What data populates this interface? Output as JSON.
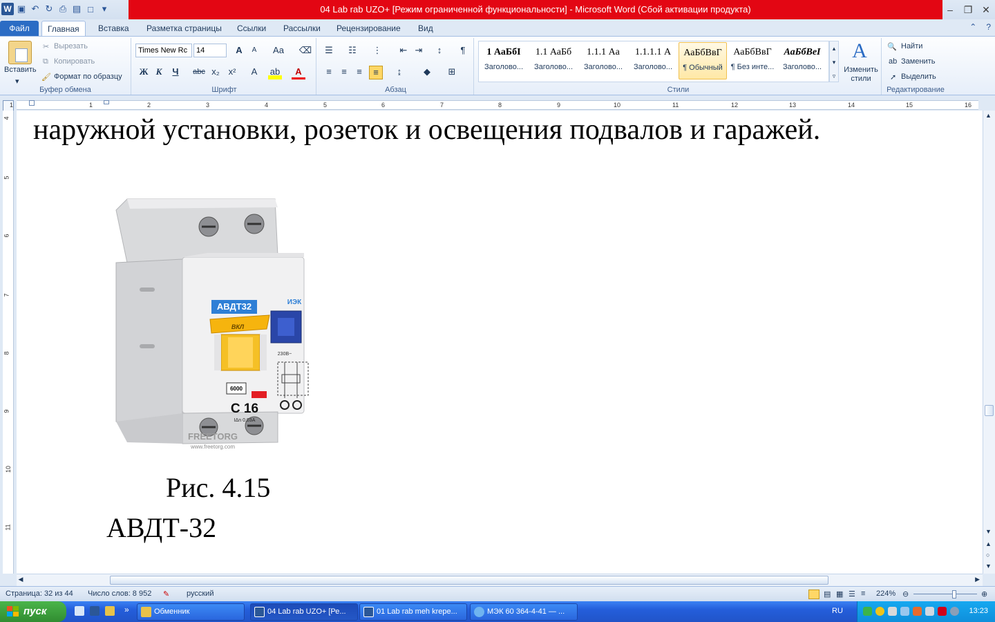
{
  "window": {
    "title": "04 Lab rab UZO+ [Режим ограниченной функциональности]  -  Microsoft Word (Сбой активации продукта)"
  },
  "tabs": {
    "file": "Файл",
    "home": "Главная",
    "insert": "Вставка",
    "layout": "Разметка страницы",
    "references": "Ссылки",
    "mailings": "Рассылки",
    "review": "Рецензирование",
    "view": "Вид"
  },
  "clipboard": {
    "paste": "Вставить",
    "cut": "Вырезать",
    "copy": "Копировать",
    "format_painter": "Формат по образцу",
    "label": "Буфер обмена"
  },
  "font": {
    "name": "Times New Rc",
    "size": "14",
    "label": "Шрифт",
    "bold": "Ж",
    "italic": "К",
    "underline": "Ч",
    "strike": "abc",
    "sub": "x₂",
    "sup": "x²",
    "grow": "A",
    "shrink": "A",
    "case": "Aa",
    "color_letter": "A"
  },
  "paragraph": {
    "label": "Абзац",
    "pilcrow": "¶"
  },
  "styles": {
    "label": "Стили",
    "items": [
      {
        "sample": "1  АаБбI",
        "name": "Заголово..."
      },
      {
        "sample": "1.1  АаБб",
        "name": "Заголово..."
      },
      {
        "sample": "1.1.1  Аа",
        "name": "Заголово..."
      },
      {
        "sample": "1.1.1.1  А",
        "name": "Заголово..."
      },
      {
        "sample": "АаБбВвГ",
        "name": "¶ Обычный"
      },
      {
        "sample": "АаБбВвГ",
        "name": "¶ Без инте..."
      },
      {
        "sample": "АаБбВеI",
        "name": "Заголово..."
      }
    ],
    "change": "Изменить стили"
  },
  "editing": {
    "label": "Редактирование",
    "find": "Найти",
    "replace": "Заменить",
    "select": "Выделить"
  },
  "ruler": {
    "h_numbers": [
      "1",
      "1",
      "2",
      "3",
      "4",
      "5",
      "6",
      "7",
      "8",
      "9",
      "10",
      "11",
      "12",
      "13",
      "14",
      "15",
      "16"
    ],
    "v_numbers": [
      "4",
      "5",
      "6",
      "7",
      "8",
      "9",
      "10",
      "11"
    ]
  },
  "document": {
    "line1": "наружной установки, розеток и освещения подвалов и гаражей.",
    "caption": "Рис. 4.15",
    "device_name": "АВДТ-32",
    "photo": {
      "label": "АВДТ32",
      "brand": "ИЭК",
      "switch_label": "ВКЛ",
      "rating": "C 16",
      "breaking": "6000",
      "residual": "IΔn 0,03A",
      "voltage": "230В~",
      "watermark": "FREETORG",
      "watermark_url": "www.freetorg.com"
    }
  },
  "statusbar": {
    "page": "Страница: 32 из 44",
    "words": "Число слов: 8 952",
    "language": "русский",
    "zoom": "224%"
  },
  "taskbar": {
    "start": "пуск",
    "items": [
      {
        "label": "Обменник",
        "active": false
      },
      {
        "label": "04 Lab rab UZO+ [Ре...",
        "active": true
      },
      {
        "label": "01 Lab rab meh krepe...",
        "active": false
      },
      {
        "label": "МЭК 60 364-4-41 — ...",
        "active": false
      }
    ],
    "lang": "RU",
    "time": "13:23"
  },
  "colors": {
    "title_bar": "#e30613",
    "file_tab": "#2b6cc4",
    "taskbar": "#245edb",
    "start": "#318c31"
  }
}
